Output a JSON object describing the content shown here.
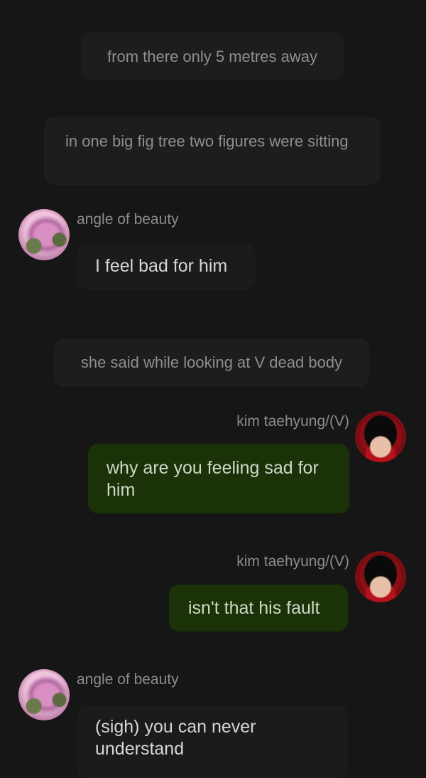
{
  "narrations": [
    "from there only 5 metres away",
    "in one big fig tree two figures were sitting",
    "she said while looking at V dead body"
  ],
  "characters": {
    "angle": {
      "name": "angle of beauty",
      "avatar_icon": "pink-figure-avatar-icon"
    },
    "v": {
      "name": "kim taehyung/(V)",
      "avatar_icon": "red-scarf-portrait-avatar-icon"
    }
  },
  "messages": [
    {
      "sender": "angle of beauty",
      "text": "I feel bad for him"
    },
    {
      "sender": "kim taehyung/(V)",
      "text": "why are you feeling sad for him"
    },
    {
      "sender": "kim taehyung/(V)",
      "text": "isn't that his fault"
    },
    {
      "sender": "angle of beauty",
      "text": "(sigh) you can never understand"
    }
  ],
  "colors": {
    "background": "#161616",
    "narration_bg": "#1d1d1d",
    "other_bubble": "#1b1b1b",
    "own_bubble": "#1b3208"
  }
}
